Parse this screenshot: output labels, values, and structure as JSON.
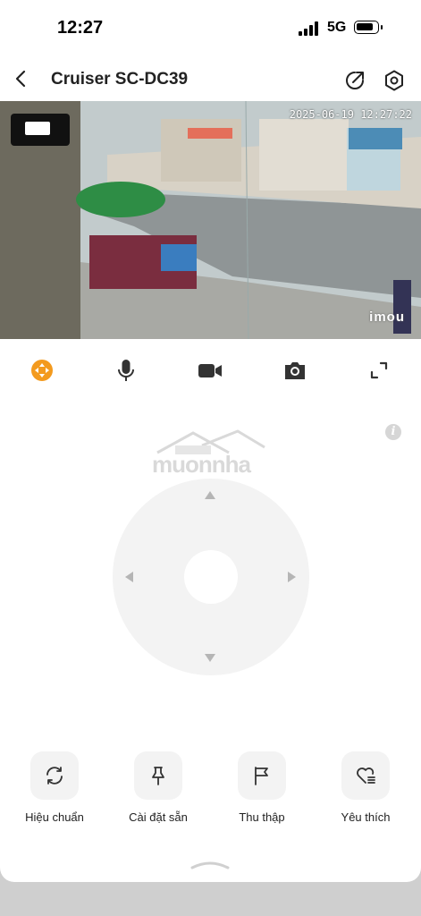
{
  "status_bar": {
    "time": "12:27",
    "network": "5G"
  },
  "header": {
    "title": "Cruiser SC-DC39"
  },
  "video": {
    "timestamp": "2025-06-19 12:27:22",
    "brand": "imou"
  },
  "controls": [
    {
      "name": "ptz-control-icon",
      "active": true,
      "color": "#f39a1e"
    },
    {
      "name": "microphone-icon"
    },
    {
      "name": "video-record-icon"
    },
    {
      "name": "snapshot-camera-icon"
    },
    {
      "name": "fullscreen-icon"
    }
  ],
  "watermark": {
    "text": "muonnha"
  },
  "actions": [
    {
      "label": "Hiệu chuẩn",
      "icon": "calibrate-refresh-icon"
    },
    {
      "label": "Cài đặt sẵn",
      "icon": "pin-icon"
    },
    {
      "label": "Thu thập",
      "icon": "flag-icon"
    },
    {
      "label": "Yêu thích",
      "icon": "heart-list-icon"
    }
  ],
  "colors": {
    "accent": "#f39a1e",
    "icon": "#333333",
    "panel": "#f3f3f3"
  }
}
